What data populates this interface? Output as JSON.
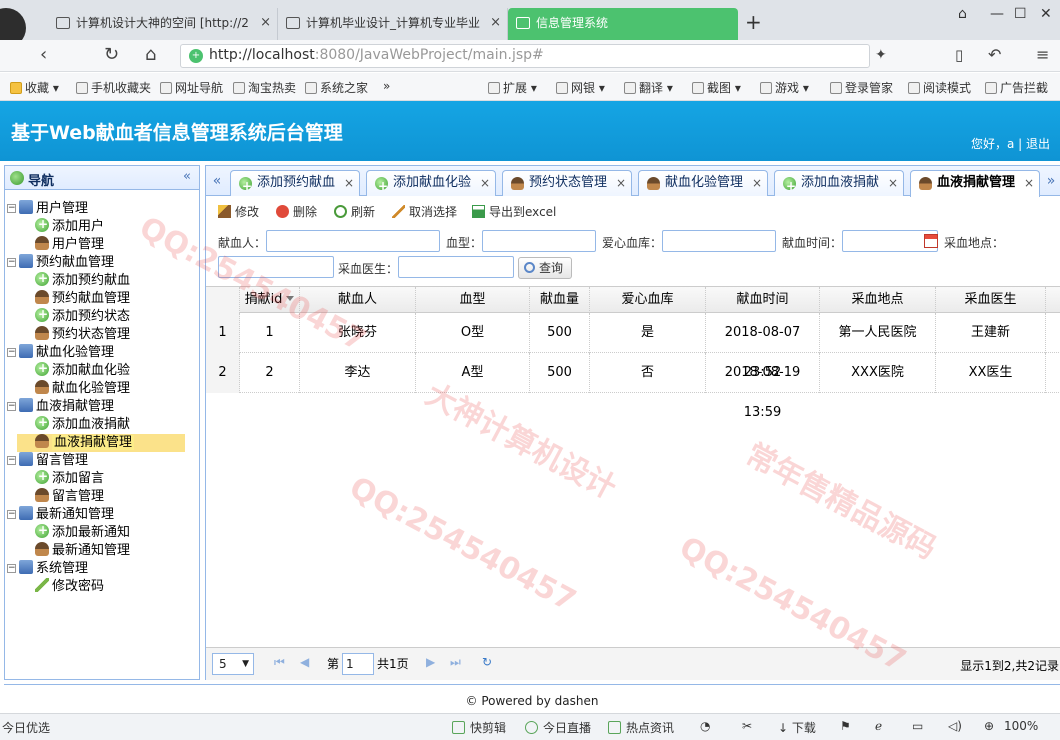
{
  "browser": {
    "tabs": [
      {
        "label": "计算机设计大神的空间 [http://2"
      },
      {
        "label": "计算机毕业设计_计算机专业毕业"
      },
      {
        "label": "信息管理系统"
      }
    ],
    "tab_close": "×",
    "new_tab": "+",
    "url_host": "http://localhost",
    "url_path": ":8080/JavaWebProject/main.jsp#",
    "bookmarks": [
      "收藏",
      "手机收藏夹",
      "网址导航",
      "淘宝热卖",
      "系统之家",
      "»",
      "扩展",
      "网银",
      "翻译",
      "截图",
      "游戏",
      "登录管家",
      "阅读模式",
      "广告拦截"
    ]
  },
  "app": {
    "title": "基于Web献血者信息管理系统后台管理",
    "user_info": "您好，a | 退出"
  },
  "sidebar": {
    "title": "导航",
    "collapse": "«",
    "groups": [
      {
        "label": "用户管理",
        "items": [
          "添加用户",
          "用户管理"
        ]
      },
      {
        "label": "预约献血管理",
        "items": [
          "添加预约献血",
          "预约献血管理",
          "添加预约状态",
          "预约状态管理"
        ]
      },
      {
        "label": "献血化验管理",
        "items": [
          "添加献血化验",
          "献血化验管理"
        ]
      },
      {
        "label": "血液捐献管理",
        "items": [
          "添加血液捐献",
          "血液捐献管理"
        ]
      },
      {
        "label": "留言管理",
        "items": [
          "添加留言",
          "留言管理"
        ]
      },
      {
        "label": "最新通知管理",
        "items": [
          "添加最新通知",
          "最新通知管理"
        ]
      },
      {
        "label": "系统管理",
        "items": [
          "修改密码"
        ]
      }
    ]
  },
  "tabs": [
    {
      "label": "添加预约献血"
    },
    {
      "label": "添加献血化验"
    },
    {
      "label": "预约状态管理"
    },
    {
      "label": "献血化验管理"
    },
    {
      "label": "添加血液捐献"
    },
    {
      "label": "血液捐献管理"
    }
  ],
  "tab_scroll_left": "«",
  "tab_scroll_right": "»",
  "toolbar": {
    "edit": "修改",
    "delete": "删除",
    "refresh": "刷新",
    "cancel_select": "取消选择",
    "export": "导出到excel"
  },
  "search": {
    "donor_label": "献血人：",
    "blood_type_label": "血型：",
    "blood_bank_label": "爱心血库：",
    "donate_time_label": "献血时间：",
    "location_label": "采血地点：",
    "doctor_label": "采血医生：",
    "search_button": "查询"
  },
  "grid": {
    "columns": [
      "",
      "捐献id",
      "献血人",
      "血型",
      "献血量",
      "爱心血库",
      "献血时间",
      "采血地点",
      "采血医生"
    ],
    "rows": [
      [
        "1",
        "1",
        "张晓芬",
        "O型",
        "500",
        "是",
        "2018-08-07 23:52",
        "第一人民医院",
        "王建新"
      ],
      [
        "2",
        "2",
        "李达",
        "A型",
        "500",
        "否",
        "2018-08-19 13:59",
        "XXX医院",
        "XX医生"
      ]
    ]
  },
  "pager": {
    "page_size": "5",
    "page_label": "第",
    "page_value": "1",
    "total_pages": "共1页",
    "info": "显示1到2,共2记录"
  },
  "footer": {
    "text": "© Powered by dashen"
  },
  "statusbar": {
    "left": "今日优选",
    "items": [
      "快剪辑",
      "今日直播",
      "热点资讯",
      "下载",
      "100%"
    ]
  },
  "watermarks": [
    "QQ:254540457",
    "大神计算机设计",
    "常年售精品源码"
  ]
}
